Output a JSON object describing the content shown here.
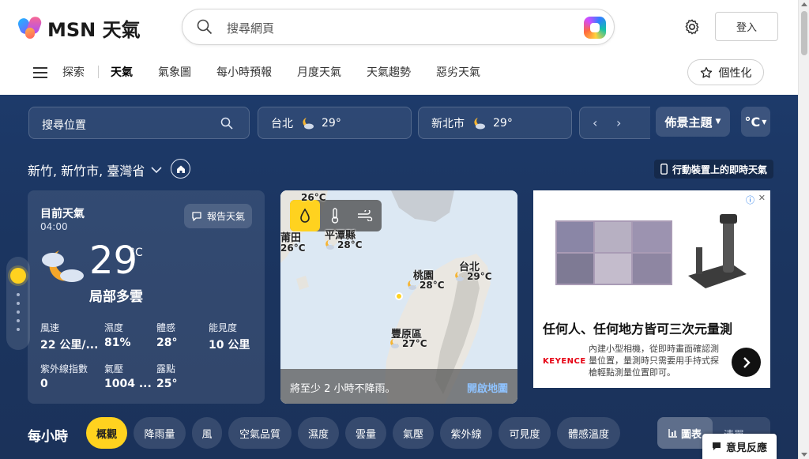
{
  "header": {
    "logo_text": "MSN 天氣",
    "search_placeholder": "搜尋網頁",
    "signin_label": "登入"
  },
  "nav": {
    "items": [
      "探索",
      "天氣",
      "氣象圖",
      "每小時預報",
      "月度天氣",
      "天氣趨勢",
      "惡劣天氣"
    ],
    "active": "天氣",
    "personalize_label": "個性化"
  },
  "toolbar": {
    "location_search_placeholder": "搜尋位置",
    "cities": [
      {
        "name": "台北",
        "temp": "29°"
      },
      {
        "name": "新北市",
        "temp": "29°"
      }
    ],
    "theme_label": "佈景主題",
    "unit_label": "°C"
  },
  "location": {
    "name": "新竹, 新竹市, 臺灣省",
    "mobile_link": "行動裝置上的即時天氣"
  },
  "current": {
    "title": "目前天氣",
    "time": "04:00",
    "report_label": "報告天氣",
    "temp": "29",
    "unit": "°C",
    "condition": "局部多雲",
    "stats": [
      {
        "label": "風速",
        "value": "22 公里/..."
      },
      {
        "label": "濕度",
        "value": "81%"
      },
      {
        "label": "體感",
        "value": "28°"
      },
      {
        "label": "能見度",
        "value": "10 公里"
      },
      {
        "label": "紫外線指數",
        "value": "0"
      },
      {
        "label": "氣壓",
        "value": "1004 ..."
      },
      {
        "label": "露點",
        "value": "25°"
      }
    ]
  },
  "map": {
    "labels": [
      {
        "name": "",
        "temp": "26°C"
      },
      {
        "name": "莆田",
        "temp": "26°C"
      },
      {
        "name": "平潭縣",
        "temp": "28°C"
      },
      {
        "name": "桃園",
        "temp": "28°C"
      },
      {
        "name": "台北",
        "temp": "29°C"
      },
      {
        "name": "豐原區",
        "temp": "27°C"
      }
    ],
    "message": "將至少 2 小時不降雨。",
    "open_label": "開啟地圖"
  },
  "ad": {
    "title": "任何人、任何地方皆可三次元量測",
    "brand": "KEYENCE",
    "description": "內建小型相機，從即時畫面確認測量位置，量測時只需要用手持式探槍輕點測量位置即可。"
  },
  "hourly": {
    "title": "每小時",
    "tabs": [
      "概觀",
      "降雨量",
      "風",
      "空氣品質",
      "濕度",
      "雲量",
      "氣壓",
      "紫外線",
      "可見度",
      "體感溫度"
    ],
    "active_tab": "概觀",
    "view_chart": "圖表",
    "view_list": "清單"
  },
  "feedback_label": "意見反應",
  "colors": {
    "accent_yellow": "#ffd21f",
    "weather_bg": "#1d3a6a"
  }
}
